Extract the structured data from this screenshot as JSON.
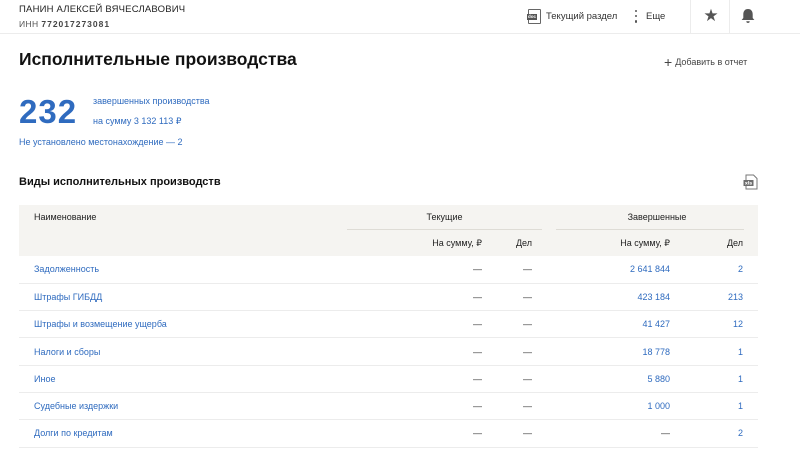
{
  "header": {
    "person_name": "ПАНИН АЛЕКСЕЙ ВЯЧЕСЛАВОВИЧ",
    "inn_label": "ИНН",
    "inn_value": "772017273081",
    "doc_tag": "doc",
    "current_section_label": "Текущий раздел",
    "more_label": "Еще"
  },
  "page": {
    "title": "Исполнительные производства",
    "add_report_label": "Добавить в отчет",
    "count": "232",
    "summary_line1": "завершенных производства",
    "summary_line2": "на сумму 3 132 113 ₽",
    "no_location": "Не установлено местонахождение — 2"
  },
  "table": {
    "section_title": "Виды исполнительных производств",
    "xls_tag": "xls",
    "headers": {
      "name": "Наименование",
      "current": "Текущие",
      "completed": "Завершенные",
      "sum": "На сумму, ₽",
      "cases": "Дел"
    },
    "rows": [
      {
        "name": "Задолженность",
        "cur_sum": "—",
        "cur_cases": "—",
        "done_sum": "2 641 844",
        "done_cases": "2"
      },
      {
        "name": "Штрафы ГИБДД",
        "cur_sum": "—",
        "cur_cases": "—",
        "done_sum": "423 184",
        "done_cases": "213"
      },
      {
        "name": "Штрафы и возмещение ущерба",
        "cur_sum": "—",
        "cur_cases": "—",
        "done_sum": "41 427",
        "done_cases": "12"
      },
      {
        "name": "Налоги и сборы",
        "cur_sum": "—",
        "cur_cases": "—",
        "done_sum": "18 778",
        "done_cases": "1"
      },
      {
        "name": "Иное",
        "cur_sum": "—",
        "cur_cases": "—",
        "done_sum": "5 880",
        "done_cases": "1"
      },
      {
        "name": "Судебные издержки",
        "cur_sum": "—",
        "cur_cases": "—",
        "done_sum": "1 000",
        "done_cases": "1"
      },
      {
        "name": "Долги по кредитам",
        "cur_sum": "—",
        "cur_cases": "—",
        "done_sum": "—",
        "done_cases": "2"
      }
    ]
  },
  "icons": {
    "doc": "doc-icon",
    "more": "dots-icon",
    "star": "star-icon",
    "bell": "bell-icon",
    "plus": "plus-icon",
    "xls": "xls-icon"
  },
  "colors": {
    "accent_blue": "#2f6bbf",
    "header_bg": "#f5f4f1"
  }
}
